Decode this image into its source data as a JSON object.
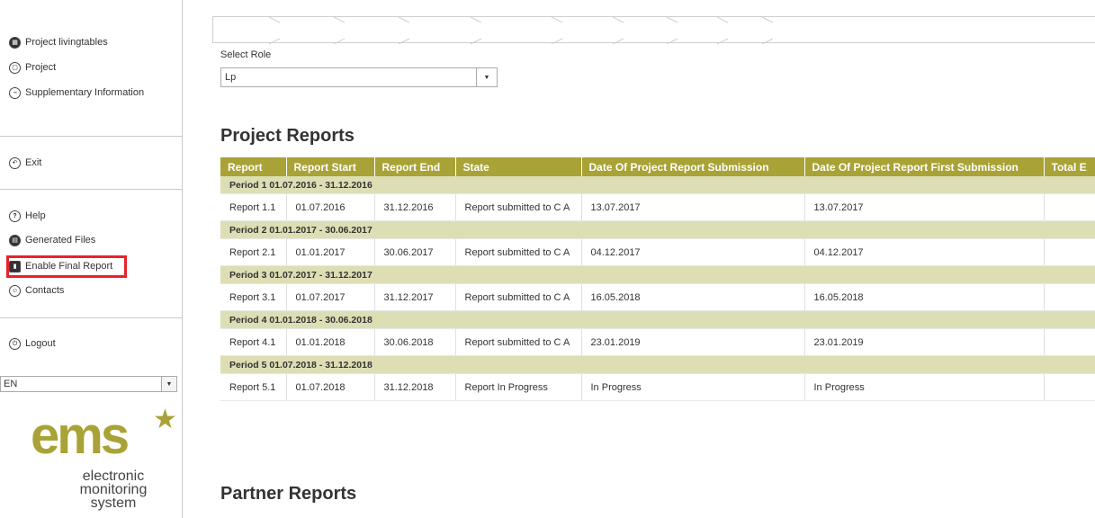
{
  "sidebar": {
    "items_top": [
      {
        "label": "Project livingtables",
        "icon": "table-icon"
      },
      {
        "label": "Project",
        "icon": "project-icon"
      },
      {
        "label": "Supplementary Information",
        "icon": "info-icon"
      }
    ],
    "exit_label": "Exit",
    "items_mid": [
      {
        "label": "Help",
        "icon": "help-icon"
      },
      {
        "label": "Generated Files",
        "icon": "files-icon"
      },
      {
        "label": "Enable Final Report",
        "icon": "report-icon"
      },
      {
        "label": "Contacts",
        "icon": "contacts-icon"
      }
    ],
    "logout_label": "Logout",
    "language": "EN",
    "logo": {
      "brand": "ems",
      "tagline_1": "electronic",
      "tagline_2": "monitoring",
      "tagline_3": "system"
    }
  },
  "main": {
    "select_role_label": "Select Role",
    "select_role_value": "Lp",
    "project_reports_title": "Project Reports",
    "partner_reports_title": "Partner Reports",
    "columns": [
      "Report",
      "Report Start",
      "Report End",
      "State",
      "Date Of Project Report Submission",
      "Date Of Project Report First Submission",
      "Total E"
    ],
    "periods": [
      {
        "label": "Period 1 01.07.2016 - 31.12.2016",
        "report": "Report 1.1",
        "start": "01.07.2016",
        "end": "31.12.2016",
        "state": "Report submitted to C A",
        "submission": "13.07.2017",
        "first_submission": "13.07.2017"
      },
      {
        "label": "Period 2 01.01.2017 - 30.06.2017",
        "report": "Report 2.1",
        "start": "01.01.2017",
        "end": "30.06.2017",
        "state": "Report submitted to C A",
        "submission": "04.12.2017",
        "first_submission": "04.12.2017"
      },
      {
        "label": "Period 3 01.07.2017 - 31.12.2017",
        "report": "Report 3.1",
        "start": "01.07.2017",
        "end": "31.12.2017",
        "state": "Report submitted to C A",
        "submission": "16.05.2018",
        "first_submission": "16.05.2018"
      },
      {
        "label": "Period 4 01.01.2018 - 30.06.2018",
        "report": "Report 4.1",
        "start": "01.01.2018",
        "end": "30.06.2018",
        "state": "Report submitted to C A",
        "submission": "23.01.2019",
        "first_submission": "23.01.2019"
      },
      {
        "label": "Period 5 01.07.2018 - 31.12.2018",
        "report": "Report 5.1",
        "start": "01.07.2018",
        "end": "31.12.2018",
        "state": "Report In Progress",
        "submission": "In Progress",
        "first_submission": "In Progress"
      }
    ]
  },
  "colors": {
    "accent": "#a9a236",
    "period_row": "#dddeb4",
    "highlight": "#e8222a"
  }
}
